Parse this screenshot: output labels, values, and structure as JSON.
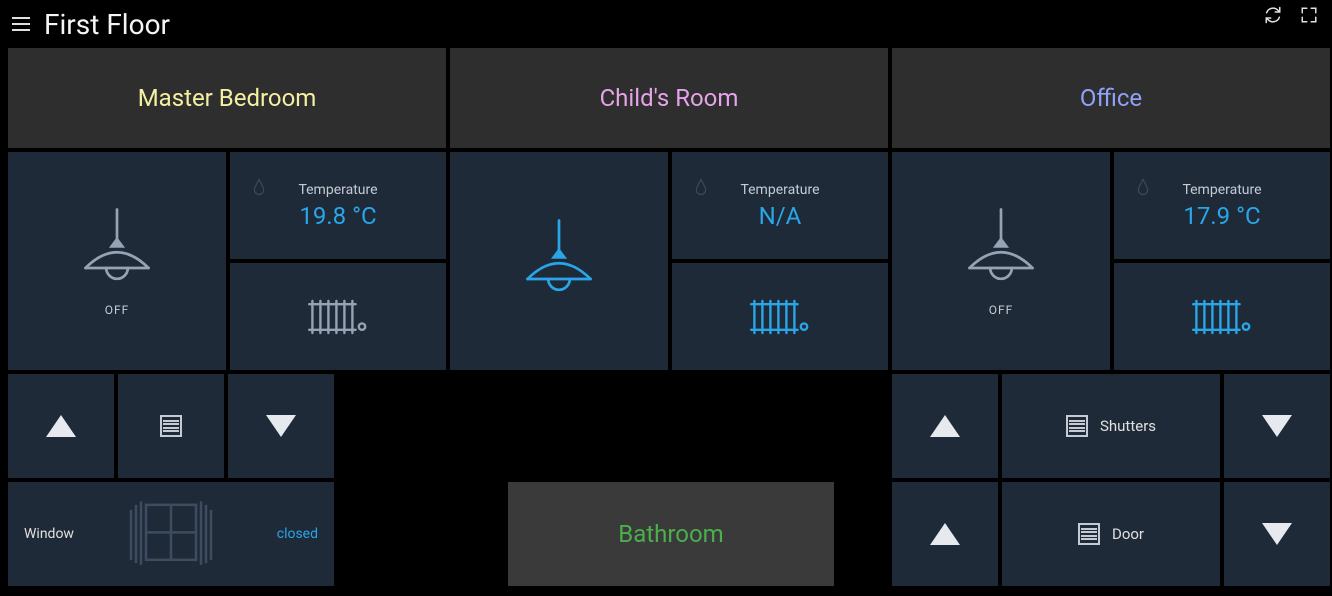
{
  "page": {
    "title": "First Floor"
  },
  "rooms": {
    "master": {
      "title": "Master Bedroom",
      "light_state": "OFF",
      "temp_label": "Temperature",
      "temp_value": "19.8 °C",
      "window_label": "Window",
      "window_status": "closed"
    },
    "child": {
      "title": "Child's Room",
      "temp_label": "Temperature",
      "temp_value": "N/A"
    },
    "office": {
      "title": "Office",
      "light_state": "OFF",
      "temp_label": "Temperature",
      "temp_value": "17.9 °C",
      "shutters_label": "Shutters",
      "door_label": "Door"
    },
    "bathroom": {
      "title": "Bathroom"
    }
  },
  "colors": {
    "accent": "#29a5e8",
    "tile": "#1f2a38",
    "header_tile": "#2e2e2e"
  }
}
